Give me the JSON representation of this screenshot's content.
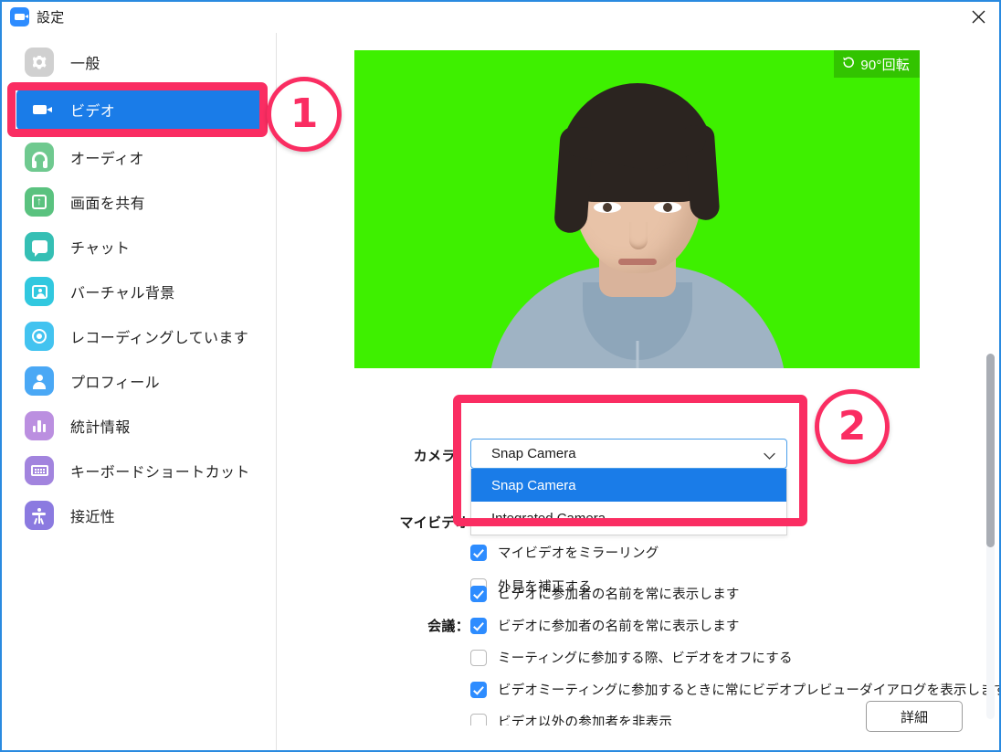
{
  "window": {
    "title": "設定",
    "logo_icon": "zoom-logo-icon",
    "close_icon": "close-icon"
  },
  "sidebar": {
    "items": [
      {
        "label": "一般",
        "icon": "gear-icon",
        "icon_color": "#d0d0d0",
        "active": false
      },
      {
        "label": "ビデオ",
        "icon": "video-camera-icon",
        "icon_color": "#1a7ce8",
        "active": true
      },
      {
        "label": "オーディオ",
        "icon": "headphones-icon",
        "icon_color": "#6fc98f",
        "active": false
      },
      {
        "label": "画面を共有",
        "icon": "screen-share-icon",
        "icon_color": "#5ac27f",
        "active": false
      },
      {
        "label": "チャット",
        "icon": "chat-bubble-icon",
        "icon_color": "#35bfb4",
        "active": false
      },
      {
        "label": "バーチャル背景",
        "icon": "virtual-background-icon",
        "icon_color": "#31c8df",
        "active": false
      },
      {
        "label": "レコーディングしています",
        "icon": "record-icon",
        "icon_color": "#43c3f0",
        "active": false
      },
      {
        "label": "プロフィール",
        "icon": "profile-person-icon",
        "icon_color": "#4aa8f5",
        "active": false
      },
      {
        "label": "統計情報",
        "icon": "bar-chart-icon",
        "icon_color": "#bb8fe0",
        "active": false
      },
      {
        "label": "キーボードショートカット",
        "icon": "keyboard-icon",
        "icon_color": "#a284de",
        "active": false
      },
      {
        "label": "接近性",
        "icon": "accessibility-icon",
        "icon_color": "#8b7ae0",
        "active": false
      }
    ]
  },
  "video_preview": {
    "rotate_button_label": "90°回転",
    "rotate_icon": "rotate-ccw-icon",
    "background_color": "#3ef000"
  },
  "settings": {
    "camera": {
      "label": "カメラ：",
      "selected_value": "Snap Camera",
      "chevron_icon": "chevron-down-icon",
      "options": [
        {
          "label": "Snap Camera",
          "selected": true
        },
        {
          "label": "Integrated Camera",
          "selected": false
        }
      ]
    },
    "my_video": {
      "label": "マイビデオ",
      "checkboxes": [
        {
          "label": "マイビデオをミラーリング",
          "checked": true
        },
        {
          "label": "外見を補正する",
          "checked": false
        }
      ]
    },
    "meeting": {
      "label": "会議：",
      "checkboxes": [
        {
          "label": "ビデオに参加者の名前を常に表示します",
          "checked": true
        },
        {
          "label": "ミーティングに参加する際、ビデオをオフにする",
          "checked": false
        },
        {
          "label": "ビデオミーティングに参加するときに常にビデオプレビューダイアログを表示します",
          "checked": true
        },
        {
          "label": "ビデオ以外の参加者を非表示",
          "checked": false
        }
      ]
    },
    "advanced_button_label": "詳細"
  },
  "annotations": {
    "accent_color": "#fa2d62",
    "step_one": "①",
    "step_one_number": "1",
    "step_two": "②",
    "step_two_number": "2"
  }
}
